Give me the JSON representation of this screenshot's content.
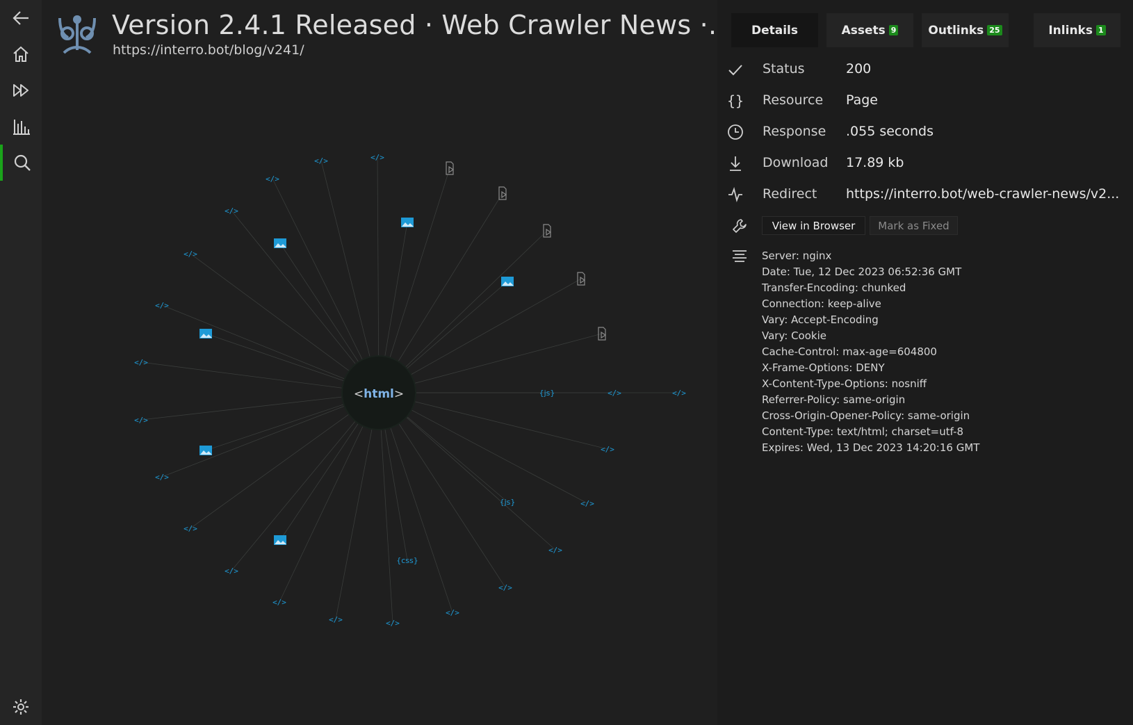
{
  "header": {
    "title": "Version 2.4.1 Released · Web Crawler News ·...",
    "url": "https://interro.bot/blog/v241/"
  },
  "sidebar": {
    "items": [
      {
        "name": "back",
        "icon": "arrow-left-icon"
      },
      {
        "name": "home",
        "icon": "home-icon"
      },
      {
        "name": "crawl",
        "icon": "fast-forward-icon"
      },
      {
        "name": "reports",
        "icon": "bar-chart-icon"
      },
      {
        "name": "search",
        "icon": "search-icon",
        "active": true
      }
    ],
    "settings_icon": "gear-icon"
  },
  "graph": {
    "center_label": "html",
    "nodes": [
      {
        "type": "page"
      },
      {
        "type": "page"
      },
      {
        "type": "page"
      },
      {
        "type": "page"
      },
      {
        "type": "page"
      },
      {
        "type": "page"
      },
      {
        "type": "page"
      },
      {
        "type": "page"
      },
      {
        "type": "page"
      },
      {
        "type": "page"
      },
      {
        "type": "page"
      },
      {
        "type": "page"
      },
      {
        "type": "page"
      },
      {
        "type": "page"
      },
      {
        "type": "page"
      },
      {
        "type": "page"
      },
      {
        "type": "page"
      },
      {
        "type": "page"
      },
      {
        "type": "page"
      },
      {
        "type": "page"
      },
      {
        "type": "page"
      },
      {
        "type": "page"
      },
      {
        "type": "page"
      },
      {
        "type": "page"
      },
      {
        "type": "image"
      },
      {
        "type": "image"
      },
      {
        "type": "image"
      },
      {
        "type": "image"
      },
      {
        "type": "image"
      },
      {
        "type": "image"
      },
      {
        "type": "js"
      },
      {
        "type": "js"
      },
      {
        "type": "css"
      },
      {
        "type": "doc"
      },
      {
        "type": "doc"
      },
      {
        "type": "doc"
      },
      {
        "type": "doc"
      },
      {
        "type": "doc"
      }
    ]
  },
  "tabs": [
    {
      "label": "Details",
      "active": true
    },
    {
      "label": "Assets",
      "badge": "9"
    },
    {
      "label": "Outlinks",
      "badge": "25"
    },
    {
      "label": "Inlinks",
      "badge": "1"
    }
  ],
  "details": {
    "rows": [
      {
        "icon": "check-icon",
        "label": "Status",
        "value": "200"
      },
      {
        "icon": "braces-icon",
        "label": "Resource",
        "value": "Page"
      },
      {
        "icon": "clock-icon",
        "label": "Response",
        "value": ".055 seconds"
      },
      {
        "icon": "download-icon",
        "label": "Download",
        "value": "17.89 kb"
      },
      {
        "icon": "redirect-icon",
        "label": "Redirect",
        "value": "https://interro.bot/web-crawler-news/v2..."
      }
    ],
    "actions": {
      "icon": "wrench-icon",
      "view_in_browser": "View in Browser",
      "mark_as_fixed": "Mark as Fixed"
    },
    "headers_icon": "lines-icon",
    "headers": [
      "Server: nginx",
      "Date: Tue, 12 Dec 2023 06:52:36 GMT",
      "Transfer-Encoding: chunked",
      "Connection: keep-alive",
      "Vary: Accept-Encoding",
      "Vary: Cookie",
      "Cache-Control: max-age=604800",
      "X-Frame-Options: DENY",
      "X-Content-Type-Options: nosniff",
      "Referrer-Policy: same-origin",
      "Cross-Origin-Opener-Policy: same-origin",
      "Content-Type: text/html; charset=utf-8",
      "Expires: Wed, 13 Dec 2023 14:20:16 GMT"
    ]
  },
  "colors": {
    "accent": "#1aa31a",
    "node_blue": "#1e9ad6",
    "node_gray": "#8a8a8a",
    "center_text": "#7fb3e6"
  }
}
